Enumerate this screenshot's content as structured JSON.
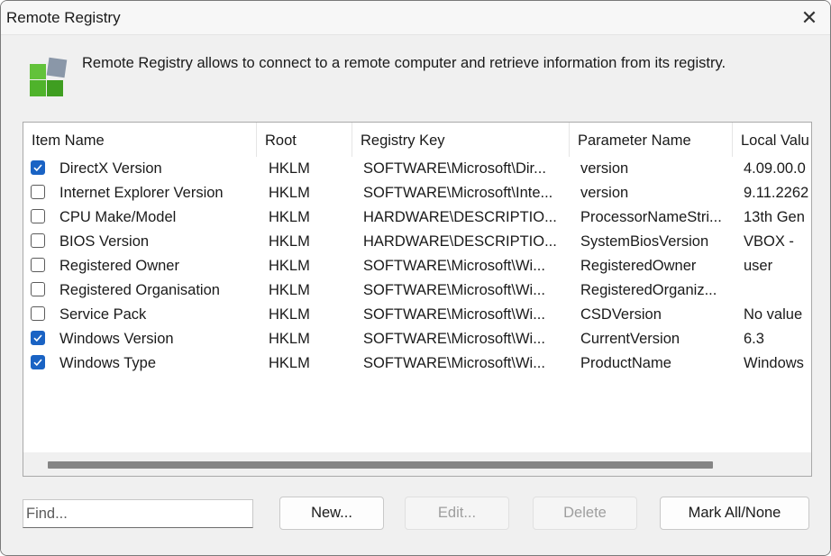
{
  "window": {
    "title": "Remote Registry",
    "close_glyph": "✕"
  },
  "description": "Remote Registry allows to connect to a remote computer and retrieve information from its registry.",
  "columns": [
    "Item Name",
    "Root",
    "Registry Key",
    "Parameter Name",
    "Local Valu"
  ],
  "rows": [
    {
      "checked": true,
      "name": "DirectX Version",
      "root": "HKLM",
      "key": "SOFTWARE\\Microsoft\\Dir...",
      "param": "version",
      "value": "4.09.00.0"
    },
    {
      "checked": false,
      "name": "Internet Explorer Version",
      "root": "HKLM",
      "key": "SOFTWARE\\Microsoft\\Inte...",
      "param": "version",
      "value": "9.11.2262"
    },
    {
      "checked": false,
      "name": "CPU Make/Model",
      "root": "HKLM",
      "key": "HARDWARE\\DESCRIPTIO...",
      "param": "ProcessorNameStri...",
      "value": "13th Gen"
    },
    {
      "checked": false,
      "name": "BIOS Version",
      "root": "HKLM",
      "key": "HARDWARE\\DESCRIPTIO...",
      "param": "SystemBiosVersion",
      "value": "VBOX   -"
    },
    {
      "checked": false,
      "name": "Registered Owner",
      "root": "HKLM",
      "key": "SOFTWARE\\Microsoft\\Wi...",
      "param": "RegisteredOwner",
      "value": "user"
    },
    {
      "checked": false,
      "name": "Registered Organisation",
      "root": "HKLM",
      "key": "SOFTWARE\\Microsoft\\Wi...",
      "param": "RegisteredOrganiz...",
      "value": ""
    },
    {
      "checked": false,
      "name": "Service Pack",
      "root": "HKLM",
      "key": "SOFTWARE\\Microsoft\\Wi...",
      "param": "CSDVersion",
      "value": "No value"
    },
    {
      "checked": true,
      "name": "Windows Version",
      "root": "HKLM",
      "key": "SOFTWARE\\Microsoft\\Wi...",
      "param": "CurrentVersion",
      "value": "6.3"
    },
    {
      "checked": true,
      "name": "Windows Type",
      "root": "HKLM",
      "key": "SOFTWARE\\Microsoft\\Wi...",
      "param": "ProductName",
      "value": "Windows"
    }
  ],
  "find": {
    "placeholder": "Find..."
  },
  "buttons": {
    "new": "New...",
    "edit": "Edit...",
    "delete": "Delete",
    "mark": "Mark All/None"
  },
  "colors": {
    "accent": "#1a63c4",
    "logo_green": "#4fb32b",
    "logo_gray": "#8a97a8"
  }
}
